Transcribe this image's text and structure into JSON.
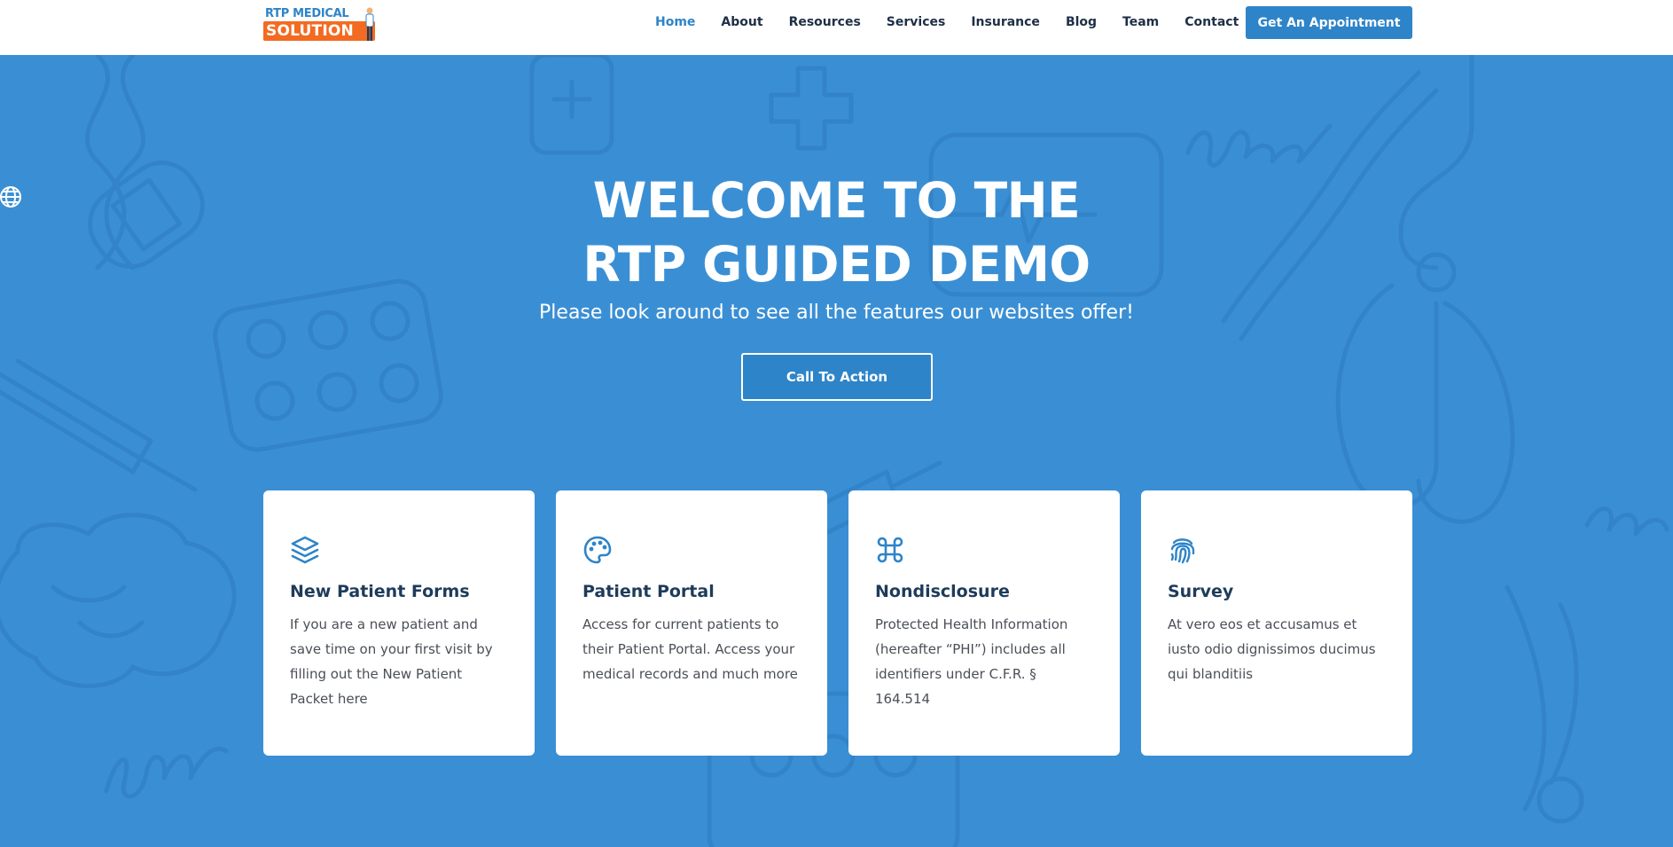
{
  "logo": {
    "line1": "RTP MEDICAL",
    "line2": "SOLUTION"
  },
  "nav": {
    "items": [
      "Home",
      "About",
      "Resources",
      "Services",
      "Insurance",
      "Blog",
      "Team",
      "Contact"
    ],
    "active": "Home",
    "appointment_label": "Get An Appointment"
  },
  "hero": {
    "title_line1": "WELCOME TO THE",
    "title_line2": "RTP GUIDED DEMO",
    "subtitle": "Please look around to see all the features our websites offer!",
    "cta_label": "Call To Action"
  },
  "cards": [
    {
      "icon": "layers-icon",
      "title": "New Patient Forms",
      "description": "If you are a new patient and save time on your first visit by filling out the New Patient Packet here"
    },
    {
      "icon": "palette-icon",
      "title": "Patient Portal",
      "description": "Access for current patients to their Patient Portal. Access your medical records and much more"
    },
    {
      "icon": "command-icon",
      "title": "Nondisclosure",
      "description": "Protected Health Information (hereafter “PHI”) includes all identifiers under C.F.R. § 164.514"
    },
    {
      "icon": "fingerprint-icon",
      "title": "Survey",
      "description": "At vero eos et accusamus et iusto odio dignissimos ducimus qui blanditiis"
    }
  ],
  "colors": {
    "brand_blue": "#2e84c8",
    "hero_background": "#3a8fd4",
    "logo_orange": "#f26b21",
    "nav_text": "#1e2f45",
    "card_title": "#1e3b5a"
  }
}
